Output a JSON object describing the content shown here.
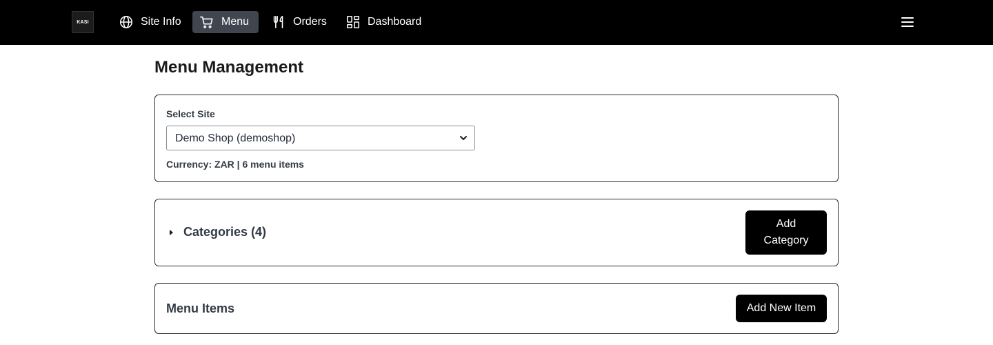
{
  "header": {
    "logo_text": "KASI",
    "nav": [
      {
        "label": "Site Info",
        "icon": "globe-icon"
      },
      {
        "label": "Menu",
        "icon": "cart-icon",
        "active": true
      },
      {
        "label": "Orders",
        "icon": "utensils-icon"
      },
      {
        "label": "Dashboard",
        "icon": "dashboard-icon"
      }
    ],
    "menu_icon": "hamburger-icon"
  },
  "page": {
    "title": "Menu Management"
  },
  "site_card": {
    "label": "Select Site",
    "selected_site": "Demo Shop (demoshop)",
    "info": "Currency: ZAR | 6 menu items"
  },
  "categories_card": {
    "title": "Categories (4)",
    "add_button": "Add Category"
  },
  "items_card": {
    "title": "Menu Items",
    "add_button": "Add New Item"
  },
  "colors": {
    "header_bg": "#000000",
    "nav_active_bg": "#3f4650",
    "button_bg": "#000000",
    "text_muted": "#333a44"
  }
}
